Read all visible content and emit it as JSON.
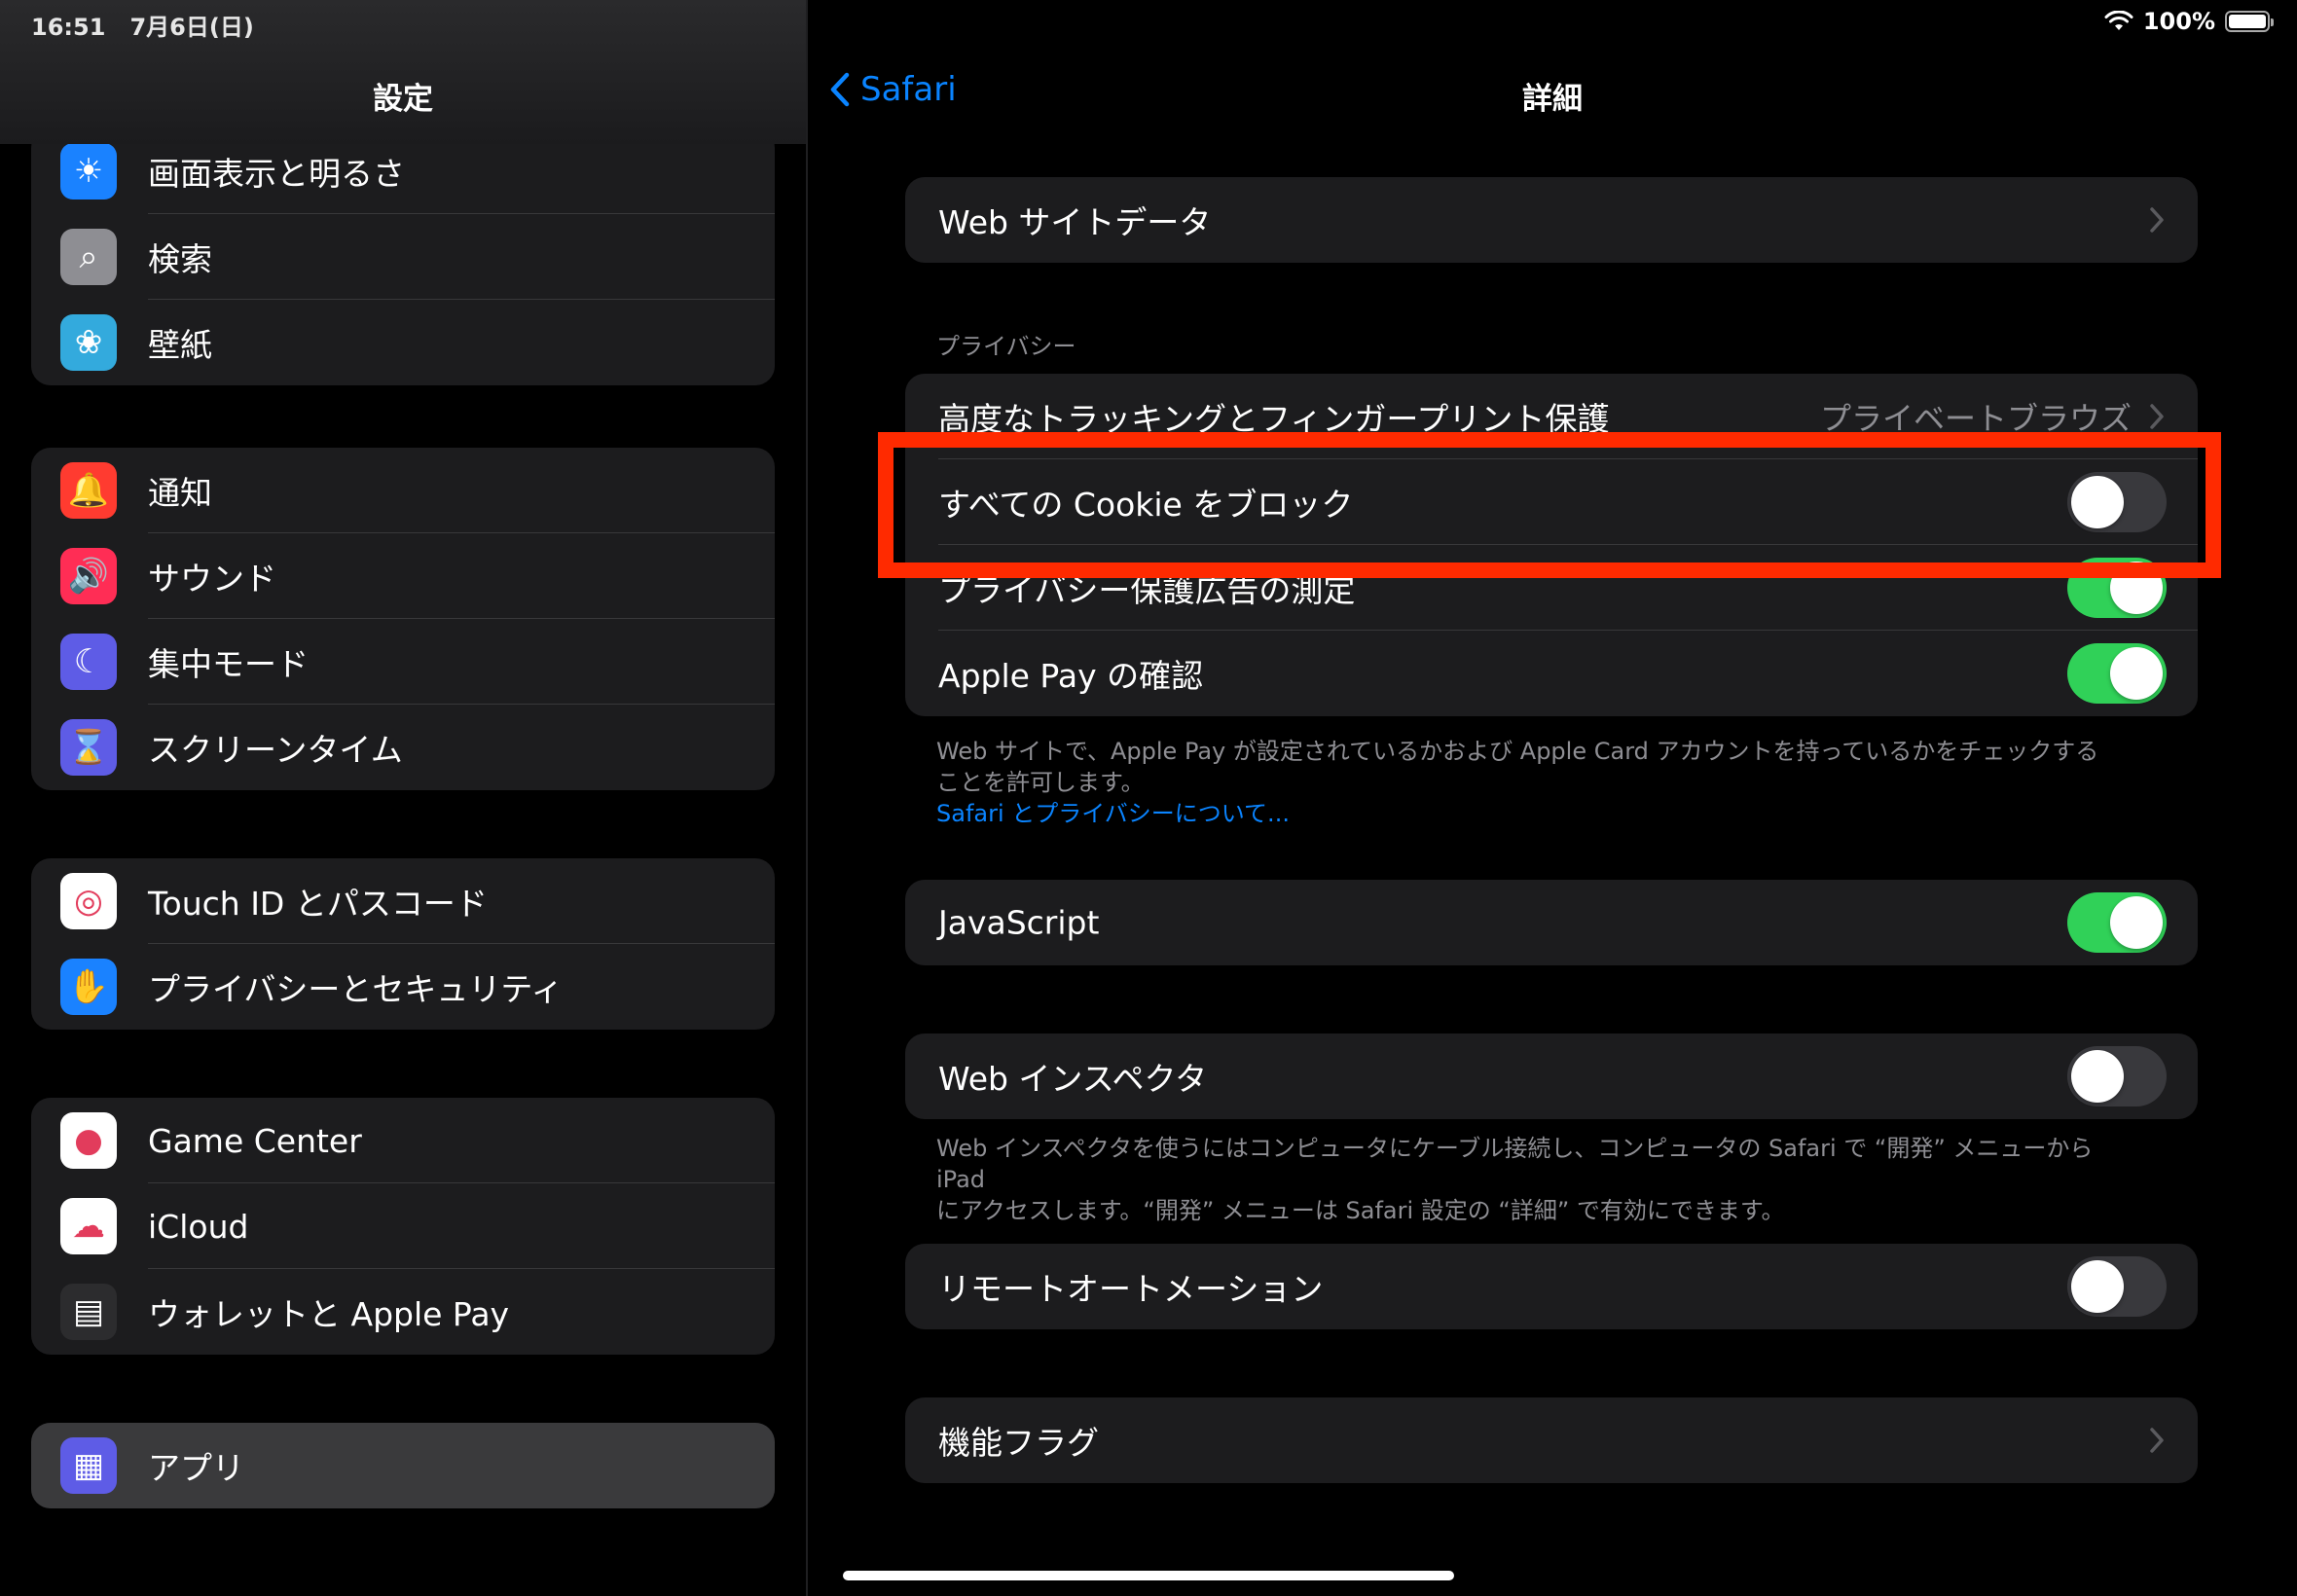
{
  "status": {
    "time": "16:51",
    "date": "7月6日(日)",
    "battery": "100%"
  },
  "sidebar": {
    "title": "設定",
    "group1": [
      {
        "label": "画面表示と明るさ",
        "icon": "brightness-icon",
        "color": "#1a82ff",
        "glyph": "☀"
      },
      {
        "label": "検索",
        "icon": "search-icon",
        "color": "#8e8e93",
        "glyph": "⌕"
      },
      {
        "label": "壁紙",
        "icon": "wallpaper-icon",
        "color": "#33aadd",
        "glyph": "❀"
      }
    ],
    "group2": [
      {
        "label": "通知",
        "icon": "notification-bell-icon",
        "color": "#ff3b30",
        "glyph": "🔔"
      },
      {
        "label": "サウンド",
        "icon": "speaker-icon",
        "color": "#ff2d55",
        "glyph": "🔊"
      },
      {
        "label": "集中モード",
        "icon": "moon-icon",
        "color": "#5e5ce6",
        "glyph": "☾"
      },
      {
        "label": "スクリーンタイム",
        "icon": "hourglass-icon",
        "color": "#5e5ce6",
        "glyph": "⌛"
      }
    ],
    "group3": [
      {
        "label": "Touch ID とパスコード",
        "icon": "fingerprint-icon",
        "color": "#ffffff",
        "glyph": "◎"
      },
      {
        "label": "プライバシーとセキュリティ",
        "icon": "hand-icon",
        "color": "#1a82ff",
        "glyph": "✋"
      }
    ],
    "group4": [
      {
        "label": "Game Center",
        "icon": "game-center-icon",
        "color": "#ffffff",
        "glyph": "●"
      },
      {
        "label": "iCloud",
        "icon": "cloud-icon",
        "color": "#ffffff",
        "glyph": "☁"
      },
      {
        "label": "ウォレットと Apple Pay",
        "icon": "wallet-icon",
        "color": "#2c2c2e",
        "glyph": "▤"
      }
    ],
    "group5": [
      {
        "label": "アプリ",
        "icon": "apps-grid-icon",
        "color": "#5e5ce6",
        "glyph": "▦"
      }
    ]
  },
  "detail": {
    "back_label": "Safari",
    "title": "詳細",
    "website_data": "Web サイトデータ",
    "privacy_header": "プライバシー",
    "tracking_label": "高度なトラッキングとフィンガープリント保護",
    "tracking_value": "プライベートブラウズ",
    "block_cookies_label": "すべての Cookie をブロック",
    "block_cookies_on": false,
    "ad_measurement_label": "プライバシー保護広告の測定",
    "ad_measurement_on": true,
    "apple_pay_label": "Apple Pay の確認",
    "apple_pay_on": true,
    "apple_pay_footer_1": "Web サイトで、Apple Pay が設定されているかおよび Apple Card アカウントを持っているかをチェックする",
    "apple_pay_footer_2": "ことを許可します。",
    "apple_pay_footer_link": "Safari とプライバシーについて...",
    "javascript_label": "JavaScript",
    "javascript_on": true,
    "web_inspector_label": "Web インスペクタ",
    "web_inspector_on": false,
    "web_inspector_footer_1": "Web インスペクタを使うにはコンピュータにケーブル接続し、コンピュータの Safari で “開発” メニューから iPad",
    "web_inspector_footer_2": "にアクセスします。“開発” メニューは Safari 設定の “詳細” で有効にできます。",
    "remote_automation_label": "リモートオートメーション",
    "remote_automation_on": false,
    "feature_flags_label": "機能フラグ"
  },
  "colors": {
    "accent": "#0a84ff",
    "toggle_on": "#30d158",
    "highlight": "#ff2a00"
  }
}
